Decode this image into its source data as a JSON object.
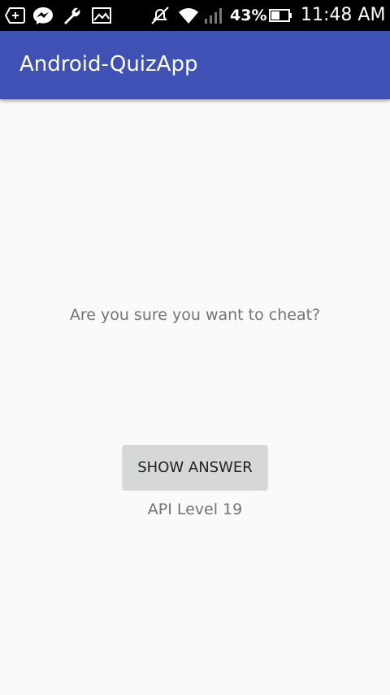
{
  "status_bar": {
    "icons": [
      "add-box-icon",
      "messenger-icon",
      "wrench-icon",
      "image-icon",
      "mute-icon",
      "wifi-icon",
      "signal-icon",
      "battery-icon"
    ],
    "battery_percent": "43%",
    "time": "11:48 AM"
  },
  "app_bar": {
    "title": "Android-QuizApp",
    "color": "#3f51b5"
  },
  "cheat": {
    "question": "Are you sure you want to cheat?",
    "show_answer_label": "SHOW ANSWER",
    "api_level": "API Level 19"
  }
}
